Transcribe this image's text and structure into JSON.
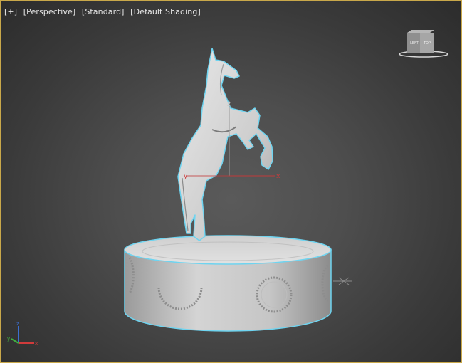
{
  "viewport": {
    "labels": {
      "plus": "[+]",
      "view": "[Perspective]",
      "shading_mode": "[Standard]",
      "shading": "[Default Shading]"
    },
    "viewcube": {
      "face_label": "TOP",
      "side_label": "LEFT"
    },
    "gizmo": {
      "x_label": "x",
      "y_label": "y",
      "z_label": "z"
    },
    "tripod": {
      "x_label": "x",
      "y_label": "y",
      "z_label": "z"
    },
    "colors": {
      "active_border": "#c9a84a",
      "model": "#d8d8d8",
      "selection_outline": "#6fd4f0",
      "axis_x": "#d03b3b",
      "axis_y": "#3fb33f",
      "axis_z": "#3b6fd0"
    }
  }
}
